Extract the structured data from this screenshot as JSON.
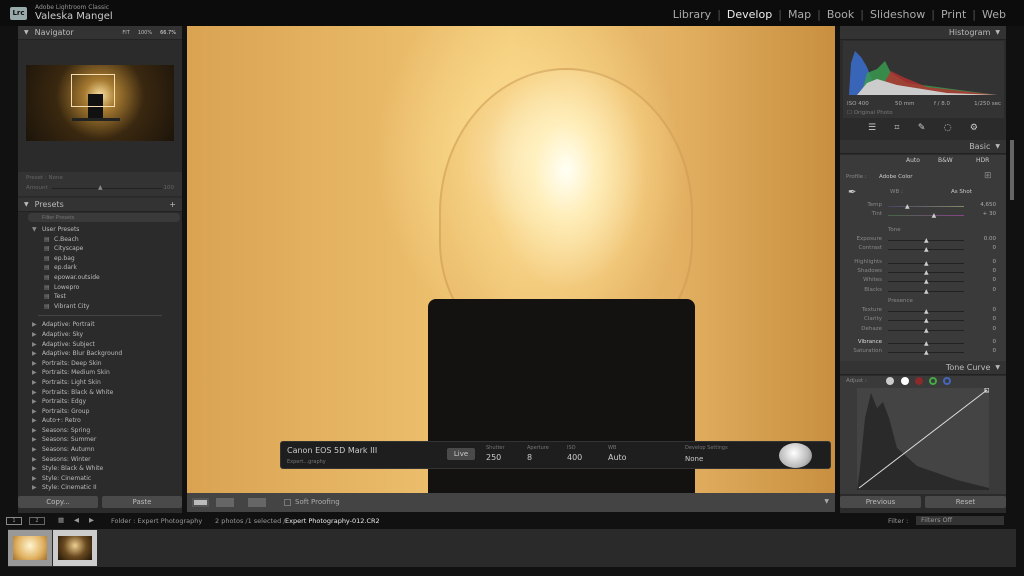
{
  "app": {
    "logo": "Lrc",
    "name": "Adobe Lightroom Classic",
    "user": "Valeska Mangel"
  },
  "modules": [
    {
      "label": "Library"
    },
    {
      "label": "Develop",
      "active": true
    },
    {
      "label": "Map"
    },
    {
      "label": "Book"
    },
    {
      "label": "Slideshow"
    },
    {
      "label": "Print"
    },
    {
      "label": "Web"
    }
  ],
  "navigator": {
    "title": "Navigator",
    "zoom": [
      "FIT",
      "100%",
      "66.7%"
    ]
  },
  "preset_amount": {
    "label": "Preset : None",
    "amount_label": "Amount",
    "amount": "100"
  },
  "presets": {
    "title": "Presets",
    "search_placeholder": "Filter Presets",
    "user_group": "User Presets",
    "user_items": [
      "C.Beach",
      "Cityscape",
      "ep.bag",
      "ep.dark",
      "epowar.outside",
      "Lowepro",
      "Test",
      "Vibrant City"
    ],
    "groups": [
      "Adaptive: Portrait",
      "Adaptive: Sky",
      "Adaptive: Subject",
      "Adaptive: Blur Background",
      "Portraits: Deep Skin",
      "Portraits: Medium Skin",
      "Portraits: Light Skin",
      "Portraits: Black & White",
      "Portraits: Edgy",
      "Portraits: Group",
      "Auto+: Retro",
      "Seasons: Spring",
      "Seasons: Summer",
      "Seasons: Autumn",
      "Seasons: Winter",
      "Style: Black & White",
      "Style: Cinematic",
      "Style: Cinematic II"
    ]
  },
  "left_buttons": {
    "copy": "Copy...",
    "paste": "Paste"
  },
  "tether": {
    "camera": "Canon EOS 5D Mark III",
    "session": "Expert...graphy",
    "live": "Live",
    "shutter_label": "Shutter",
    "shutter": "250",
    "aperture_label": "Aperture",
    "aperture": "8",
    "iso_label": "ISO",
    "iso": "400",
    "wb_label": "WB",
    "wb": "Auto",
    "settings_label": "Develop Settings",
    "settings": "None"
  },
  "toolbar": {
    "soft_proofing": "Soft Proofing"
  },
  "histogram": {
    "title": "Histogram",
    "iso": "ISO 400",
    "focal": "50 mm",
    "aperture": "f / 8.0",
    "shutter": "1/250 sec",
    "original": "Original Photo"
  },
  "basic": {
    "title": "Basic",
    "auto": "Auto",
    "bw": "B&W",
    "hdr": "HDR",
    "profile_label": "Profile :",
    "profile": "Adobe Color",
    "wb_label": "WB :",
    "wb": "As Shot",
    "wb_rows": [
      {
        "label": "Temp",
        "value": "4,650",
        "pos": 0.25
      },
      {
        "label": "Tint",
        "value": "+ 30",
        "pos": 0.6
      }
    ],
    "tone_label": "Tone",
    "tone_rows": [
      {
        "label": "Exposure",
        "value": "0.00"
      },
      {
        "label": "Contrast",
        "value": "0"
      },
      {
        "label": "Highlights",
        "value": "0"
      },
      {
        "label": "Shadows",
        "value": "0"
      },
      {
        "label": "Whites",
        "value": "0"
      },
      {
        "label": "Blacks",
        "value": "0"
      }
    ],
    "presence_label": "Presence",
    "presence_rows": [
      {
        "label": "Texture",
        "value": "0"
      },
      {
        "label": "Clarity",
        "value": "0"
      },
      {
        "label": "Dehaze",
        "value": "0"
      },
      {
        "label": "Vibrance",
        "value": "0"
      },
      {
        "label": "Saturation",
        "value": "0"
      }
    ]
  },
  "tone_curve": {
    "title": "Tone Curve",
    "adjust": "Adjust :"
  },
  "right_buttons": {
    "previous": "Previous",
    "reset": "Reset"
  },
  "filmstrip": {
    "view1": "1",
    "view2": "2",
    "folder": "Folder : Expert Photography",
    "count": "2 photos /1 selected /",
    "file": "Expert Photography-012.CR2",
    "filter_label": "Filter :",
    "filter": "Filters Off",
    "thumbs": [
      "1",
      "2"
    ]
  }
}
